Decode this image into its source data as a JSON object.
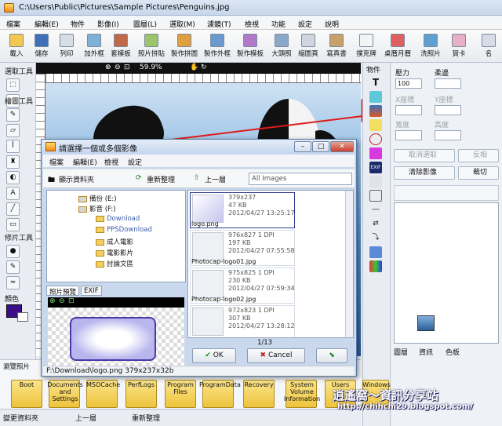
{
  "window": {
    "title": "C:\\Users\\Public\\Pictures\\Sample Pictures\\Penguins.jpg"
  },
  "menu": [
    "檔案",
    "編輯(E)",
    "物件",
    "影像(I)",
    "圖層(L)",
    "選取(M)",
    "濾鏡(T)",
    "檢視",
    "功能",
    "設定",
    "說明"
  ],
  "toolbar": [
    "載入",
    "儲存",
    "列印",
    "加外框",
    "套模板",
    "照片拼貼",
    "製作拼圖",
    "製作外框",
    "製作模板",
    "大頭照",
    "縮圖頁",
    "寫真書",
    "撲克牌",
    "桌曆月曆",
    "洗照片",
    "賀卡",
    "名"
  ],
  "left_tools": {
    "select_label": "選取工具",
    "draw_label": "繪圖工具",
    "repair_label": "修片工具",
    "color_label": "顏色"
  },
  "canvas_bar": {
    "zoom": "59.9%"
  },
  "right_panel": {
    "rotate_label": "旋轉",
    "size_label": "壓力",
    "size_value": "100",
    "blend_label": "柔邊",
    "x_label": "X座標",
    "y_label": "Y座標",
    "w_label": "寬度",
    "h_label": "高度",
    "cancel_select": "取消選取",
    "invert": "反相",
    "clear_image": "清除影像",
    "crop": "裁切",
    "tabs": [
      "圖層",
      "資訊",
      "色板"
    ]
  },
  "right_tools": {
    "label": "物件",
    "exif": "EXIF"
  },
  "dialog": {
    "title": "請選擇一個或多個影像",
    "menu": [
      "檔案",
      "編輯(E)",
      "檢視",
      "設定"
    ],
    "show_folder": "顯示資料夾",
    "refresh": "重新整理",
    "up": "上一層",
    "filter": "All Images",
    "tree": [
      "備份 (E:)",
      "影音 (F:)",
      "Download",
      "PPSDownload",
      "成人電影",
      "電影影片",
      "討論文區"
    ],
    "tabs": [
      "照片預覽",
      "EXIF"
    ],
    "files": [
      {
        "meta": "379x237\n47 KB\n2012/04/27 13:25:17",
        "name": "logo.png"
      },
      {
        "meta": "976x827 1 DPI\n197 KB\n2012/04/27 07:55:58",
        "name": "Photocap-logo01.jpg"
      },
      {
        "meta": "975x825 1 DPI\n230 KB\n2012/04/27 07:59:34",
        "name": "Photocap-logo02.jpg"
      },
      {
        "meta": "972x823 1 DPI\n307 KB\n2012/04/27 13:28:12",
        "name": ""
      }
    ],
    "page": "1/13",
    "ok": "OK",
    "cancel": "Cancel",
    "status": "F:\\Download\\logo.png   379x237x32b"
  },
  "browser": {
    "tab": "瀏覽照片",
    "folders": [
      "Boot",
      "Documents and Settings",
      "MSOCache",
      "PerfLogs",
      "Program Files",
      "ProgramData",
      "Recovery",
      "System Volume Information",
      "Users",
      "Windows"
    ],
    "status_change": "變更資料夾",
    "status_up": "上一層",
    "status_refresh": "重新整理"
  },
  "watermark": {
    "title": "逍遙窩～資訊分享站",
    "url": "http://chihchi29.blogspot.com/"
  },
  "colors": {
    "accent_red": "#e01b1b",
    "primary_color": "#3b0f8a"
  }
}
